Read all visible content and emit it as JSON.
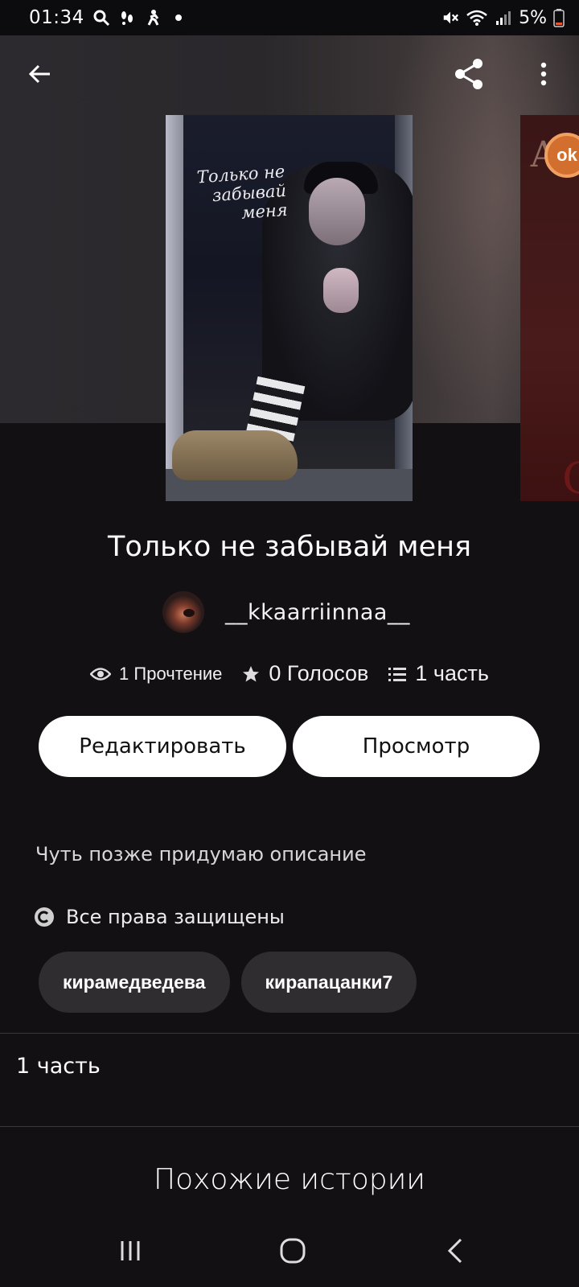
{
  "status_bar": {
    "time": "01:34",
    "battery_text": "5%",
    "icons": [
      "search-icon",
      "steps-icon",
      "walk-icon",
      "dot-icon",
      "mute-icon",
      "wifi-icon",
      "signal-icon",
      "battery-icon"
    ]
  },
  "toolbar": {
    "back_icon": "arrow-left-icon",
    "share_icon": "share-icon",
    "more_icon": "more-vert-icon"
  },
  "cover": {
    "title_text": "Только не забывай меня"
  },
  "next_cover": {
    "letter": "А",
    "badge_text": "ok",
    "swirl": "G"
  },
  "story": {
    "title": "Только не забывай меня",
    "author": "__kkaarriinnaa__",
    "reads": "1 Прочтение",
    "votes": "0 Голосов",
    "parts": "1 часть",
    "description": "Чуть позже придумаю описание",
    "rights": "Все права защищены",
    "tags": [
      "кирамедведева",
      "кирапацанки7"
    ]
  },
  "actions": {
    "edit_label": "Редактировать",
    "view_label": "Просмотр"
  },
  "parts_section": {
    "label": "1 часть"
  },
  "similar": {
    "heading": "Похожие истории"
  },
  "colors": {
    "background": "#121013",
    "button_bg": "#ffffff",
    "tag_bg": "#2f2d30"
  }
}
